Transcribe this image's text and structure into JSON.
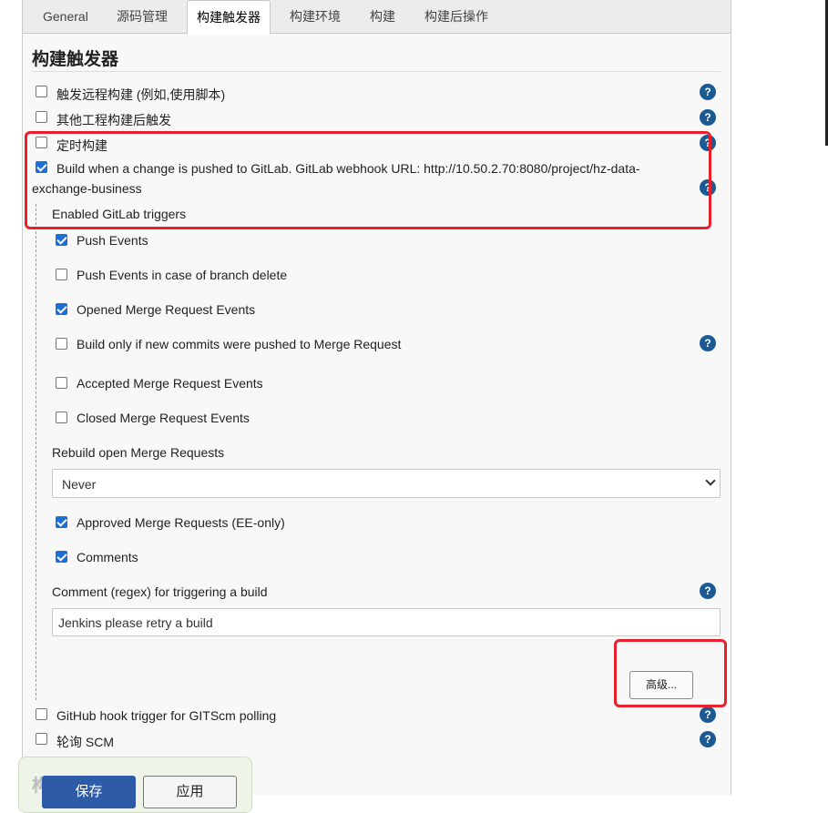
{
  "tabs": [
    {
      "label": "General"
    },
    {
      "label": "源码管理"
    },
    {
      "label": "构建触发器"
    },
    {
      "label": "构建环境"
    },
    {
      "label": "构建"
    },
    {
      "label": "构建后操作"
    }
  ],
  "section_title": "构建触发器",
  "triggers": {
    "remote": {
      "label": "触发远程构建 (例如,使用脚本)",
      "checked": false
    },
    "after_other": {
      "label": "其他工程构建后触发",
      "checked": false
    },
    "timed": {
      "label": "定时构建",
      "checked": false
    },
    "gitlab": {
      "label_line1": "Build when a change is pushed to GitLab. GitLab webhook URL: http://10.50.2.70:8080/project/hz-data-",
      "label_line2": "exchange-business",
      "checked": true
    },
    "github_hook": {
      "label": "GitHub hook trigger for GITScm polling",
      "checked": false
    },
    "poll_scm": {
      "label": "轮询 SCM",
      "checked": false
    }
  },
  "gitlab_options": {
    "heading": "Enabled GitLab triggers",
    "push_events": {
      "label": "Push Events",
      "checked": true
    },
    "push_branch_delete": {
      "label": "Push Events in case of branch delete",
      "checked": false
    },
    "opened_mr": {
      "label": "Opened Merge Request Events",
      "checked": true
    },
    "new_commits_mr": {
      "label": "Build only if new commits were pushed to Merge Request",
      "checked": false
    },
    "accepted_mr": {
      "label": "Accepted Merge Request Events",
      "checked": false
    },
    "closed_mr": {
      "label": "Closed Merge Request Events",
      "checked": false
    },
    "rebuild_label": "Rebuild open Merge Requests",
    "rebuild_value": "Never",
    "approved_mr": {
      "label": "Approved Merge Requests (EE-only)",
      "checked": true
    },
    "comments": {
      "label": "Comments",
      "checked": true
    },
    "comment_regex_label": "Comment (regex) for triggering a build",
    "comment_regex_value": "Jenkins please retry a build",
    "advanced_button": "高级..."
  },
  "help_glyph": "?",
  "footer": {
    "faded_title": "构",
    "save": "保存",
    "apply": "应用"
  },
  "colors": {
    "accent": "#1a6fd9",
    "highlight": "#e8202b",
    "help": "#1b5a93",
    "save_button": "#2d5ba8"
  }
}
